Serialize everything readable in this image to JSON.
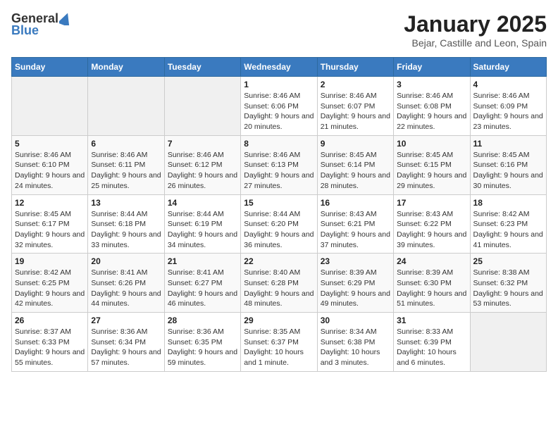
{
  "logo": {
    "general": "General",
    "blue": "Blue"
  },
  "title": "January 2025",
  "subtitle": "Bejar, Castille and Leon, Spain",
  "days_of_week": [
    "Sunday",
    "Monday",
    "Tuesday",
    "Wednesday",
    "Thursday",
    "Friday",
    "Saturday"
  ],
  "weeks": [
    [
      {
        "day": "",
        "info": ""
      },
      {
        "day": "",
        "info": ""
      },
      {
        "day": "",
        "info": ""
      },
      {
        "day": "1",
        "info": "Sunrise: 8:46 AM\nSunset: 6:06 PM\nDaylight: 9 hours and 20 minutes."
      },
      {
        "day": "2",
        "info": "Sunrise: 8:46 AM\nSunset: 6:07 PM\nDaylight: 9 hours and 21 minutes."
      },
      {
        "day": "3",
        "info": "Sunrise: 8:46 AM\nSunset: 6:08 PM\nDaylight: 9 hours and 22 minutes."
      },
      {
        "day": "4",
        "info": "Sunrise: 8:46 AM\nSunset: 6:09 PM\nDaylight: 9 hours and 23 minutes."
      }
    ],
    [
      {
        "day": "5",
        "info": "Sunrise: 8:46 AM\nSunset: 6:10 PM\nDaylight: 9 hours and 24 minutes."
      },
      {
        "day": "6",
        "info": "Sunrise: 8:46 AM\nSunset: 6:11 PM\nDaylight: 9 hours and 25 minutes."
      },
      {
        "day": "7",
        "info": "Sunrise: 8:46 AM\nSunset: 6:12 PM\nDaylight: 9 hours and 26 minutes."
      },
      {
        "day": "8",
        "info": "Sunrise: 8:46 AM\nSunset: 6:13 PM\nDaylight: 9 hours and 27 minutes."
      },
      {
        "day": "9",
        "info": "Sunrise: 8:45 AM\nSunset: 6:14 PM\nDaylight: 9 hours and 28 minutes."
      },
      {
        "day": "10",
        "info": "Sunrise: 8:45 AM\nSunset: 6:15 PM\nDaylight: 9 hours and 29 minutes."
      },
      {
        "day": "11",
        "info": "Sunrise: 8:45 AM\nSunset: 6:16 PM\nDaylight: 9 hours and 30 minutes."
      }
    ],
    [
      {
        "day": "12",
        "info": "Sunrise: 8:45 AM\nSunset: 6:17 PM\nDaylight: 9 hours and 32 minutes."
      },
      {
        "day": "13",
        "info": "Sunrise: 8:44 AM\nSunset: 6:18 PM\nDaylight: 9 hours and 33 minutes."
      },
      {
        "day": "14",
        "info": "Sunrise: 8:44 AM\nSunset: 6:19 PM\nDaylight: 9 hours and 34 minutes."
      },
      {
        "day": "15",
        "info": "Sunrise: 8:44 AM\nSunset: 6:20 PM\nDaylight: 9 hours and 36 minutes."
      },
      {
        "day": "16",
        "info": "Sunrise: 8:43 AM\nSunset: 6:21 PM\nDaylight: 9 hours and 37 minutes."
      },
      {
        "day": "17",
        "info": "Sunrise: 8:43 AM\nSunset: 6:22 PM\nDaylight: 9 hours and 39 minutes."
      },
      {
        "day": "18",
        "info": "Sunrise: 8:42 AM\nSunset: 6:23 PM\nDaylight: 9 hours and 41 minutes."
      }
    ],
    [
      {
        "day": "19",
        "info": "Sunrise: 8:42 AM\nSunset: 6:25 PM\nDaylight: 9 hours and 42 minutes."
      },
      {
        "day": "20",
        "info": "Sunrise: 8:41 AM\nSunset: 6:26 PM\nDaylight: 9 hours and 44 minutes."
      },
      {
        "day": "21",
        "info": "Sunrise: 8:41 AM\nSunset: 6:27 PM\nDaylight: 9 hours and 46 minutes."
      },
      {
        "day": "22",
        "info": "Sunrise: 8:40 AM\nSunset: 6:28 PM\nDaylight: 9 hours and 48 minutes."
      },
      {
        "day": "23",
        "info": "Sunrise: 8:39 AM\nSunset: 6:29 PM\nDaylight: 9 hours and 49 minutes."
      },
      {
        "day": "24",
        "info": "Sunrise: 8:39 AM\nSunset: 6:30 PM\nDaylight: 9 hours and 51 minutes."
      },
      {
        "day": "25",
        "info": "Sunrise: 8:38 AM\nSunset: 6:32 PM\nDaylight: 9 hours and 53 minutes."
      }
    ],
    [
      {
        "day": "26",
        "info": "Sunrise: 8:37 AM\nSunset: 6:33 PM\nDaylight: 9 hours and 55 minutes."
      },
      {
        "day": "27",
        "info": "Sunrise: 8:36 AM\nSunset: 6:34 PM\nDaylight: 9 hours and 57 minutes."
      },
      {
        "day": "28",
        "info": "Sunrise: 8:36 AM\nSunset: 6:35 PM\nDaylight: 9 hours and 59 minutes."
      },
      {
        "day": "29",
        "info": "Sunrise: 8:35 AM\nSunset: 6:37 PM\nDaylight: 10 hours and 1 minute."
      },
      {
        "day": "30",
        "info": "Sunrise: 8:34 AM\nSunset: 6:38 PM\nDaylight: 10 hours and 3 minutes."
      },
      {
        "day": "31",
        "info": "Sunrise: 8:33 AM\nSunset: 6:39 PM\nDaylight: 10 hours and 6 minutes."
      },
      {
        "day": "",
        "info": ""
      }
    ]
  ]
}
